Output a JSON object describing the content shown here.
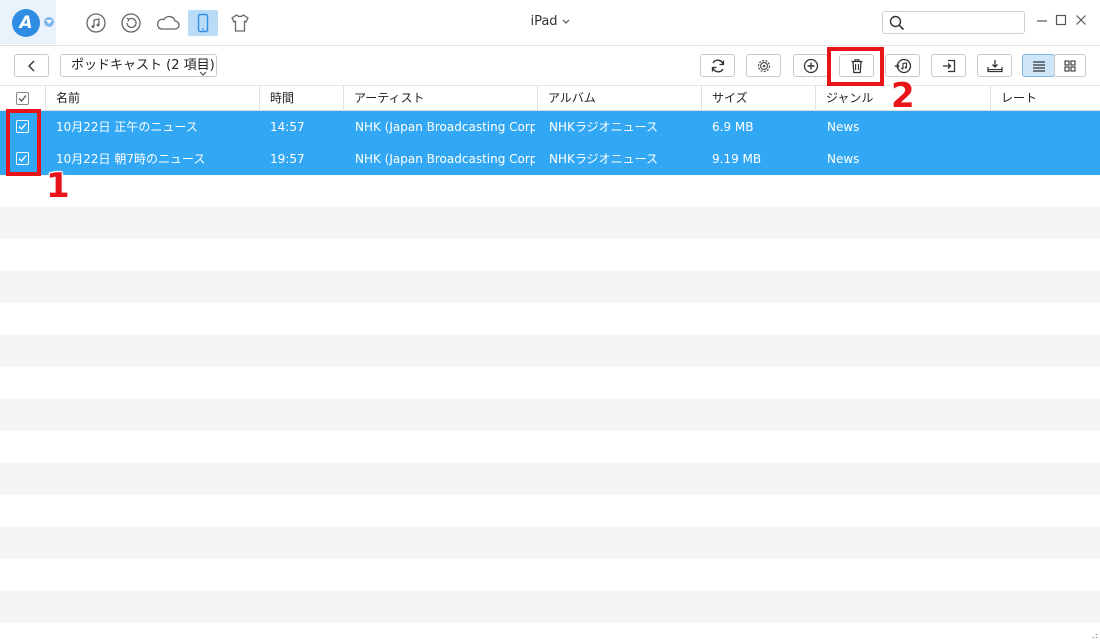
{
  "app": {
    "device_name": "iPad",
    "search": {
      "value": "",
      "placeholder": ""
    }
  },
  "top_nav": {
    "items": [
      {
        "name": "music-icon",
        "active": false
      },
      {
        "name": "restore-icon",
        "active": false
      },
      {
        "name": "icloud-icon",
        "active": false
      },
      {
        "name": "device-icon",
        "active": true
      },
      {
        "name": "shirt-icon",
        "active": false
      }
    ]
  },
  "toolbar": {
    "category_label": "ポッドキャスト (2 項目)",
    "buttons": [
      "refresh-icon",
      "settings-icon",
      "add-icon",
      "delete-icon",
      "to-itunes-icon",
      "to-computer-icon",
      "to-device-icon"
    ],
    "view_modes": [
      "list-view-icon",
      "grid-view-icon"
    ],
    "active_view": "list"
  },
  "table": {
    "columns": [
      "名前",
      "時間",
      "アーティスト",
      "アルバム",
      "サイズ",
      "ジャンル",
      "レート"
    ],
    "rows": [
      {
        "checked": true,
        "name": "10月22日 正午のニュース",
        "time": "14:57",
        "artist": "NHK (Japan Broadcasting Corp...",
        "album": "NHKラジオニュース",
        "size": "6.9 MB",
        "genre": "News",
        "rate": ""
      },
      {
        "checked": true,
        "name": "10月22日 朝7時のニュース",
        "time": "19:57",
        "artist": "NHK (Japan Broadcasting Corp...",
        "album": "NHKラジオニュース",
        "size": "9.19 MB",
        "genre": "News",
        "rate": ""
      }
    ]
  },
  "annotations": {
    "step1": "1",
    "step2": "2"
  },
  "colors": {
    "accent": "#2f8de4",
    "selection": "#32a8f5",
    "highlight": "#e8141a"
  }
}
